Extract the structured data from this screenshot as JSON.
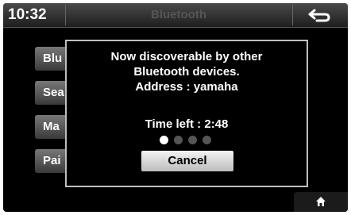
{
  "status_bar": {
    "clock": "10:32",
    "title": "Bluetooth"
  },
  "icons": {
    "back": "back-arrow-icon",
    "home": "home-icon"
  },
  "menu": {
    "items": [
      {
        "label": "Blu"
      },
      {
        "label": "Sea"
      },
      {
        "label": "Ma"
      },
      {
        "label": "Pai"
      }
    ]
  },
  "dialog": {
    "message_line1": "Now discoverable by other",
    "message_line2": "Bluetooth devices.",
    "message_line3": "Address : yamaha",
    "timer": "Time left : 2:48",
    "progress_active_dot": 1,
    "progress_dot_count": 4,
    "cancel_label": "Cancel"
  },
  "colors": {
    "background": "#000000",
    "dialog_border": "#bfbfbf",
    "text": "#ffffff"
  }
}
